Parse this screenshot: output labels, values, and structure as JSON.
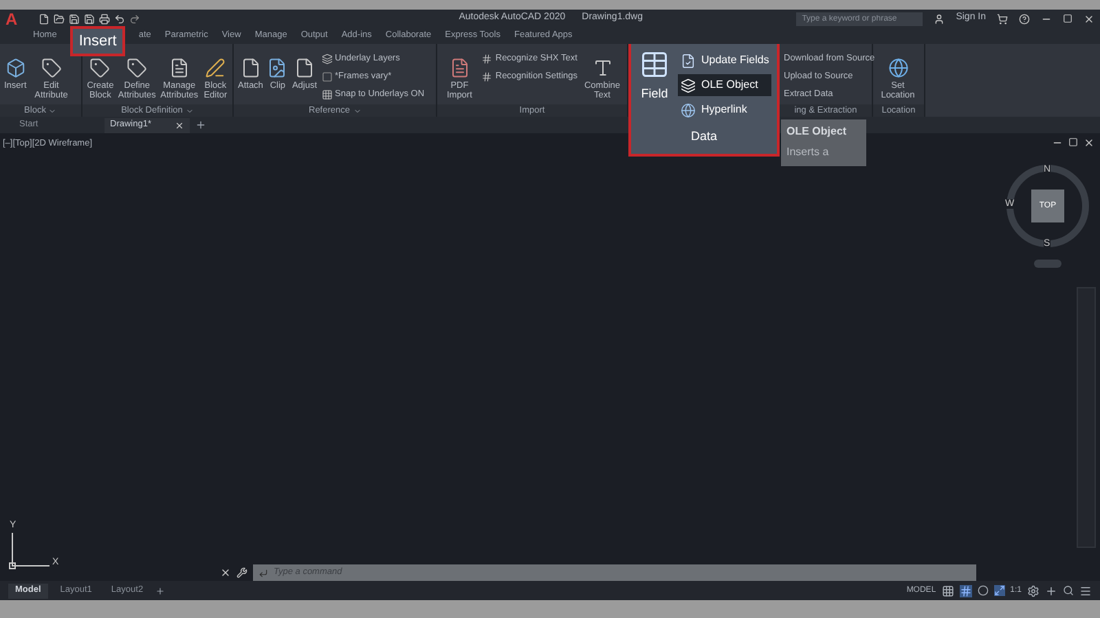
{
  "app": {
    "logo": "A",
    "title": "Autodesk AutoCAD 2020",
    "document": "Drawing1.dwg",
    "search": {
      "placeholder": "Type a keyword or phrase"
    },
    "sign_in": "Sign In"
  },
  "ribbon_tabs": [
    {
      "label": "Home",
      "selected": false
    },
    {
      "label": "Insert",
      "selected": true
    },
    {
      "label": "ate",
      "selected": false
    },
    {
      "label": "Parametric",
      "selected": false
    },
    {
      "label": "View",
      "selected": false
    },
    {
      "label": "Manage",
      "selected": false
    },
    {
      "label": "Output",
      "selected": false
    },
    {
      "label": "Add-ins",
      "selected": false
    },
    {
      "label": "Collaborate",
      "selected": false
    },
    {
      "label": "Express Tools",
      "selected": false
    },
    {
      "label": "Featured Apps",
      "selected": false
    }
  ],
  "panels": [
    {
      "kind": "standard",
      "title": "Block",
      "menu": true,
      "tools": [
        {
          "kind": "large",
          "label": "Insert"
        },
        {
          "kind": "large",
          "label": "Edit Attribute"
        }
      ]
    },
    {
      "kind": "standard",
      "title": "Block Definition",
      "menu": true,
      "tools": [
        {
          "kind": "large",
          "label": "Create Block"
        },
        {
          "kind": "large",
          "label": "Define Attributes"
        },
        {
          "kind": "large",
          "label": "Manage Attributes"
        },
        {
          "kind": "large",
          "label": "Block Editor"
        }
      ]
    },
    {
      "kind": "standard",
      "title": "Reference",
      "menu": true,
      "tools": [
        {
          "kind": "large",
          "label": "Attach"
        },
        {
          "kind": "large",
          "label": "Clip"
        },
        {
          "kind": "large",
          "label": "Adjust"
        },
        {
          "kind": "small",
          "label": "Underlay Layers"
        },
        {
          "kind": "small",
          "label": "*Frames vary*"
        },
        {
          "kind": "small",
          "label": "Snap to Underlays ON"
        }
      ]
    },
    {
      "kind": "standard",
      "title": "Import",
      "tools": [
        {
          "kind": "large",
          "label": "PDF Import"
        },
        {
          "kind": "small",
          "label": "Recognize SHX Text"
        },
        {
          "kind": "small",
          "label": "Recognition Settings"
        },
        {
          "kind": "large",
          "label": "Combine Text"
        }
      ]
    },
    {
      "kind": "callout",
      "title": "Data",
      "tools": [
        {
          "kind": "large",
          "label": "Field",
          "selected": false
        },
        {
          "kind": "small",
          "label": "Update Fields",
          "selected": false
        },
        {
          "kind": "small",
          "label": "OLE Object",
          "selected": true
        },
        {
          "kind": "small",
          "label": "Hyperlink",
          "selected": false
        }
      ]
    },
    {
      "kind": "standard",
      "title": "ing & Extraction",
      "tools": [
        {
          "kind": "small",
          "label": "Download from Source"
        },
        {
          "kind": "small",
          "label": "Upload to Source"
        },
        {
          "kind": "small",
          "label": "Extract  Data"
        }
      ]
    },
    {
      "kind": "standard",
      "title": "Location",
      "tools": [
        {
          "kind": "large",
          "label": "Set Location"
        }
      ]
    }
  ],
  "tooltip": {
    "title": "OLE Object",
    "text": "Inserts a"
  },
  "doc_tabs": [
    {
      "label": "Start",
      "selected": false
    },
    {
      "label": "Drawing1*",
      "selected": true
    }
  ],
  "viewport": {
    "label": "[–][Top][2D Wireframe]",
    "viewcube": {
      "north": "N",
      "west": "W",
      "south": "S",
      "face": "TOP"
    },
    "ucs": {
      "y": "Y",
      "x": "X"
    }
  },
  "command_line": {
    "placeholder": "Type a command"
  },
  "layout_tabs": [
    {
      "label": "Model",
      "selected": true
    },
    {
      "label": "Layout1",
      "selected": false
    },
    {
      "label": "Layout2",
      "selected": false
    }
  ],
  "status_bar": {
    "space": "MODEL",
    "scale": "1:1"
  }
}
